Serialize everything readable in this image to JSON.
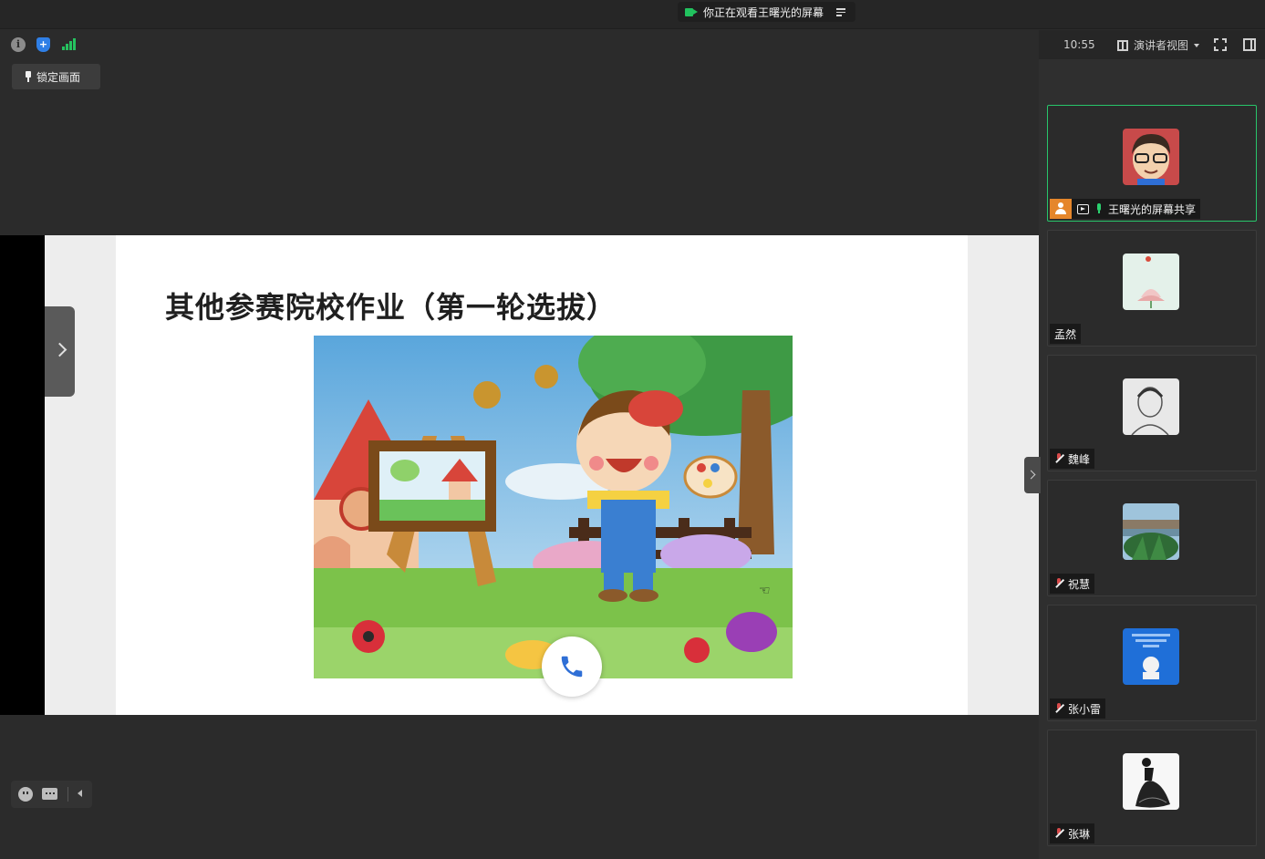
{
  "topbar": {
    "share_status": "你正在观看王曙光的屏幕",
    "share_icon": "video-share-icon",
    "list_icon": "list-menu-icon"
  },
  "infobar": {
    "info_icon": "info-icon",
    "security_icon": "shield-icon",
    "network_icon": "signal-bars-icon",
    "security_color": "#2f7fe6",
    "signal_color": "#25c25f"
  },
  "header_right": {
    "time": "10:55",
    "view_label": "演讲者视图"
  },
  "lock_button": {
    "label": "锁定画面"
  },
  "slide": {
    "title": "其他参赛院校作业（第一轮选拔）"
  },
  "participants": [
    {
      "name": "王曙光的屏幕共享",
      "mic": "on",
      "host": true,
      "sharing": true,
      "active": true
    },
    {
      "name": "孟然",
      "mic": "none",
      "host": false,
      "sharing": false,
      "active": false
    },
    {
      "name": "魏峰",
      "mic": "muted",
      "host": false,
      "sharing": false,
      "active": false
    },
    {
      "name": "祝慧",
      "mic": "muted",
      "host": false,
      "sharing": false,
      "active": false
    },
    {
      "name": "张小雷",
      "mic": "muted",
      "host": false,
      "sharing": false,
      "active": false
    },
    {
      "name": "张琳",
      "mic": "muted",
      "host": false,
      "sharing": false,
      "active": false
    }
  ],
  "colors": {
    "accent_green": "#28c56a",
    "host_orange": "#e5862b",
    "muted_red": "#d94b4b"
  }
}
